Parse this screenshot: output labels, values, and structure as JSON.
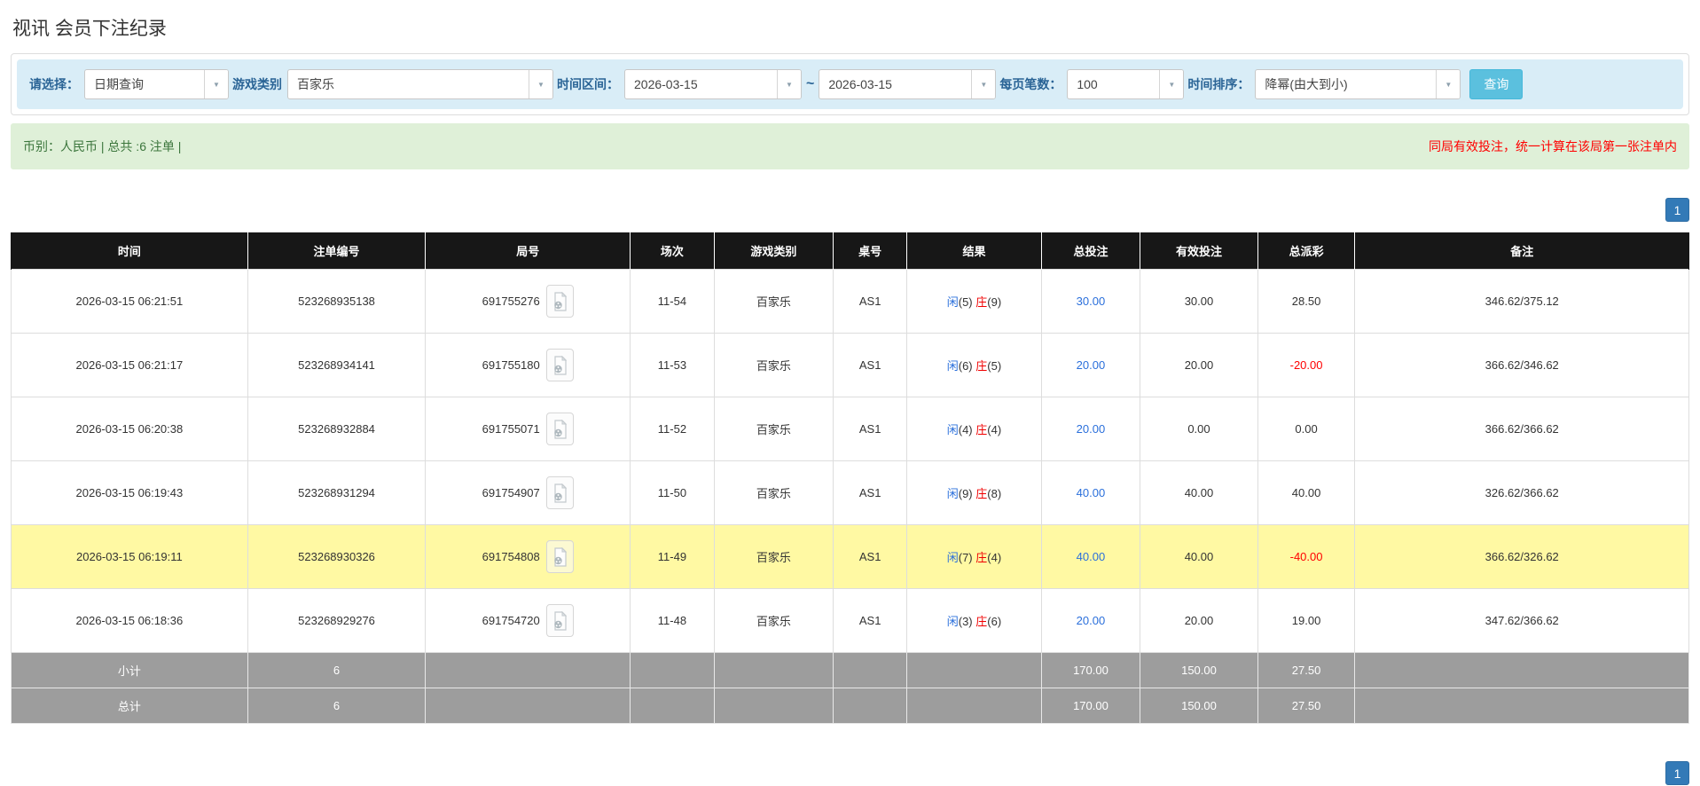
{
  "page": {
    "title": "视讯 会员下注纪录"
  },
  "filters": {
    "select_label": "请选择：",
    "select_value": "日期查询",
    "game_label": "游戏类别",
    "game_value": "百家乐",
    "range_label": "时间区间：",
    "date_from": "2026-03-15",
    "tilde": "~",
    "date_to": "2026-03-15",
    "page_size_label": "每页笔数：",
    "page_size_value": "100",
    "sort_label": "时间排序：",
    "sort_value": "降幂(由大到小)",
    "search_button": "查询",
    "dropdown_icon": "▼"
  },
  "summary_bar": {
    "left": "币别：人民币 | 总共 :6 注单 |",
    "right": "同局有效投注，统一计算在该局第一张注单内"
  },
  "pagination": {
    "page": "1"
  },
  "table": {
    "headers": [
      "时间",
      "注单编号",
      "局号",
      "场次",
      "游戏类别",
      "桌号",
      "结果",
      "总投注",
      "有效投注",
      "总派彩",
      "备注"
    ],
    "rows": [
      {
        "time": "2026-03-15 06:21:51",
        "bet_no": "523268935138",
        "round_no": "691755276",
        "session": "11-54",
        "game": "百家乐",
        "table_no": "AS1",
        "result": {
          "player_label": "闲",
          "player_score": "(5)",
          "banker_label": "庄",
          "banker_score": "(9)"
        },
        "total_bet": "30.00",
        "valid_bet": "30.00",
        "payout": "28.50",
        "remark": "346.62/375.12",
        "highlight": false
      },
      {
        "time": "2026-03-15 06:21:17",
        "bet_no": "523268934141",
        "round_no": "691755180",
        "session": "11-53",
        "game": "百家乐",
        "table_no": "AS1",
        "result": {
          "player_label": "闲",
          "player_score": "(6)",
          "banker_label": "庄",
          "banker_score": "(5)"
        },
        "total_bet": "20.00",
        "valid_bet": "20.00",
        "payout": "-20.00",
        "remark": "366.62/346.62",
        "highlight": false
      },
      {
        "time": "2026-03-15 06:20:38",
        "bet_no": "523268932884",
        "round_no": "691755071",
        "session": "11-52",
        "game": "百家乐",
        "table_no": "AS1",
        "result": {
          "player_label": "闲",
          "player_score": "(4)",
          "banker_label": "庄",
          "banker_score": "(4)"
        },
        "total_bet": "20.00",
        "valid_bet": "0.00",
        "payout": "0.00",
        "remark": "366.62/366.62",
        "highlight": false
      },
      {
        "time": "2026-03-15 06:19:43",
        "bet_no": "523268931294",
        "round_no": "691754907",
        "session": "11-50",
        "game": "百家乐",
        "table_no": "AS1",
        "result": {
          "player_label": "闲",
          "player_score": "(9)",
          "banker_label": "庄",
          "banker_score": "(8)"
        },
        "total_bet": "40.00",
        "valid_bet": "40.00",
        "payout": "40.00",
        "remark": "326.62/366.62",
        "highlight": false
      },
      {
        "time": "2026-03-15 06:19:11",
        "bet_no": "523268930326",
        "round_no": "691754808",
        "session": "11-49",
        "game": "百家乐",
        "table_no": "AS1",
        "result": {
          "player_label": "闲",
          "player_score": "(7)",
          "banker_label": "庄",
          "banker_score": "(4)"
        },
        "total_bet": "40.00",
        "valid_bet": "40.00",
        "payout": "-40.00",
        "remark": "366.62/326.62",
        "highlight": true
      },
      {
        "time": "2026-03-15 06:18:36",
        "bet_no": "523268929276",
        "round_no": "691754720",
        "session": "11-48",
        "game": "百家乐",
        "table_no": "AS1",
        "result": {
          "player_label": "闲",
          "player_score": "(3)",
          "banker_label": "庄",
          "banker_score": "(6)"
        },
        "total_bet": "20.00",
        "valid_bet": "20.00",
        "payout": "19.00",
        "remark": "347.62/366.62",
        "highlight": false
      }
    ],
    "subtotal": {
      "label": "小计",
      "count": "6",
      "total_bet": "170.00",
      "valid_bet": "150.00",
      "payout": "27.50"
    },
    "total": {
      "label": "总计",
      "count": "6",
      "total_bet": "170.00",
      "valid_bet": "150.00",
      "payout": "27.50"
    }
  }
}
